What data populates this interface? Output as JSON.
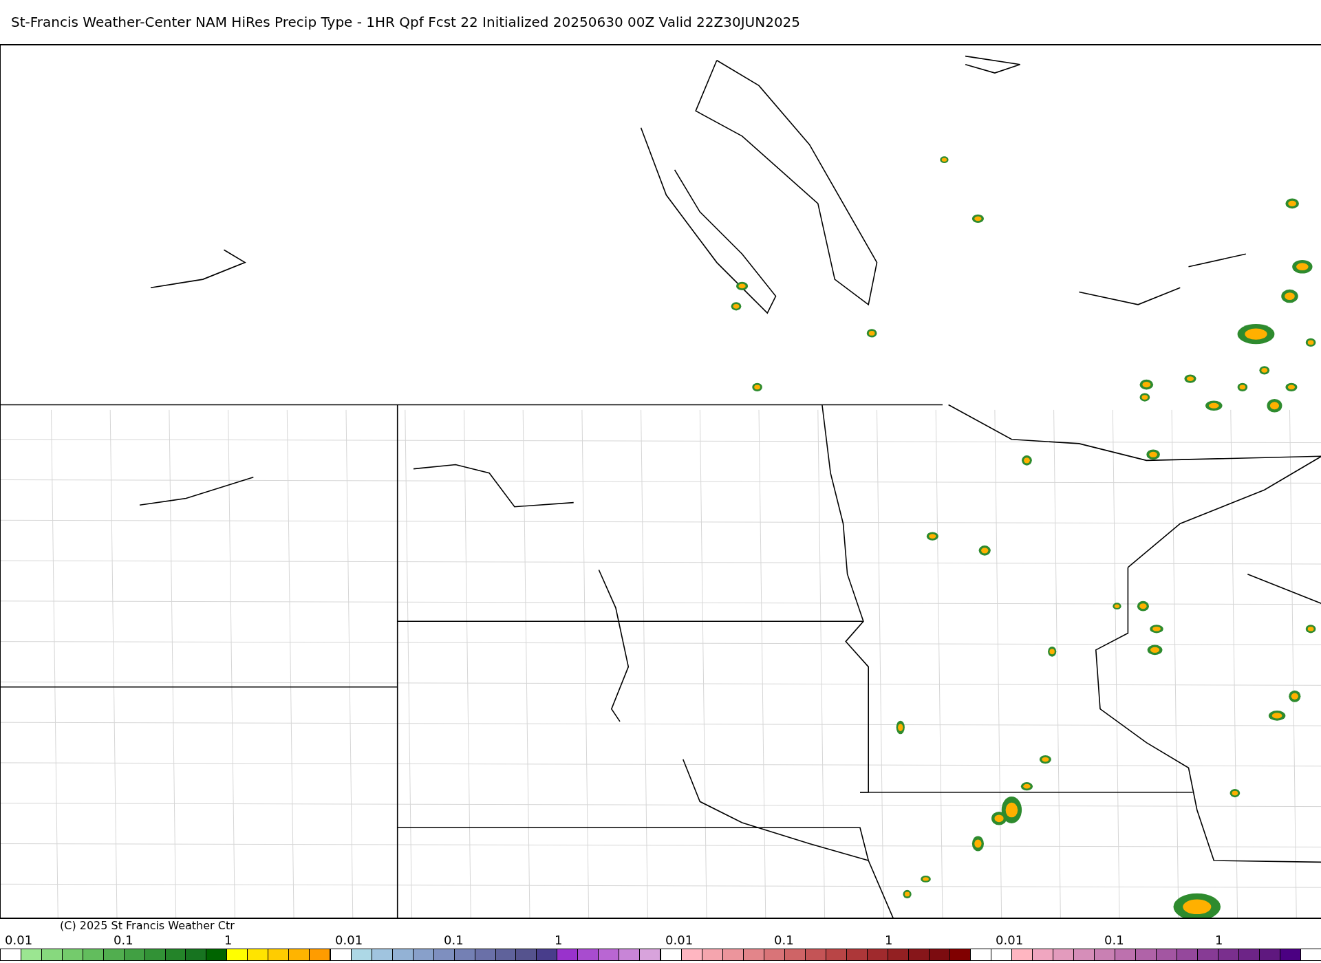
{
  "title": "St-Francis Weather-Center NAM HiRes Precip Type - 1HR Qpf Fcst 22 Initialized 20250630 00Z Valid 22Z30JUN2025",
  "legend": [
    {
      "labels": [
        "0.01",
        "0.1",
        "1"
      ],
      "swatches": [
        {
          "color": "#ffffff"
        },
        {
          "color": "#9be691"
        },
        {
          "color": "#87d97e"
        },
        {
          "color": "#74cb6c"
        },
        {
          "color": "#62bd5d"
        },
        {
          "color": "#51ae4f"
        },
        {
          "color": "#41a043"
        },
        {
          "color": "#329236"
        },
        {
          "color": "#248429"
        },
        {
          "color": "#177420"
        },
        {
          "color": "#006400"
        },
        {
          "color": "#ffff00"
        },
        {
          "color": "#ffe400"
        },
        {
          "color": "#ffcc00"
        },
        {
          "color": "#ffb400"
        },
        {
          "color": "#ff9c00"
        }
      ]
    },
    {
      "labels": [
        "0.01",
        "0.1",
        "1"
      ],
      "swatches": [
        {
          "color": "#ffffff"
        },
        {
          "color": "#add8e6"
        },
        {
          "color": "#a0c4df"
        },
        {
          "color": "#93b2d5"
        },
        {
          "color": "#88a0ca"
        },
        {
          "color": "#7e8fbf"
        },
        {
          "color": "#7480b4"
        },
        {
          "color": "#6a70a8"
        },
        {
          "color": "#5f629b"
        },
        {
          "color": "#55538e"
        },
        {
          "color": "#483d8b"
        },
        {
          "color": "#9932cc"
        },
        {
          "color": "#a84ccf"
        },
        {
          "color": "#b966d3"
        },
        {
          "color": "#c885d7"
        },
        {
          "color": "#d8a3dc"
        }
      ]
    },
    {
      "labels": [
        "0.01",
        "0.1",
        "1"
      ],
      "swatches": [
        {
          "color": "#ffffff"
        },
        {
          "color": "#ffb6c1"
        },
        {
          "color": "#f5a5ae"
        },
        {
          "color": "#ec959c"
        },
        {
          "color": "#e3858a"
        },
        {
          "color": "#d97478"
        },
        {
          "color": "#cf6466"
        },
        {
          "color": "#c45456"
        },
        {
          "color": "#b94546"
        },
        {
          "color": "#ad3739"
        },
        {
          "color": "#a02a2d"
        },
        {
          "color": "#932022"
        },
        {
          "color": "#87161a"
        },
        {
          "color": "#7c0c10"
        },
        {
          "color": "#800000"
        }
      ]
    },
    {
      "labels": [
        "0.01",
        "0.1",
        "1"
      ],
      "swatches": [
        {
          "color": "#ffffff"
        },
        {
          "color": "#ffb6c1"
        },
        {
          "color": "#f0a6c0"
        },
        {
          "color": "#e39bbd"
        },
        {
          "color": "#d68eb9"
        },
        {
          "color": "#c980b3"
        },
        {
          "color": "#bd71ae"
        },
        {
          "color": "#b063a8"
        },
        {
          "color": "#a356a2"
        },
        {
          "color": "#95489c"
        },
        {
          "color": "#873b95"
        },
        {
          "color": "#7a2f8e"
        },
        {
          "color": "#6d2487"
        },
        {
          "color": "#5f187f"
        },
        {
          "color": "#4b0082"
        }
      ]
    }
  ],
  "copyright": "(C) 2025 St Francis Weather Ctr"
}
